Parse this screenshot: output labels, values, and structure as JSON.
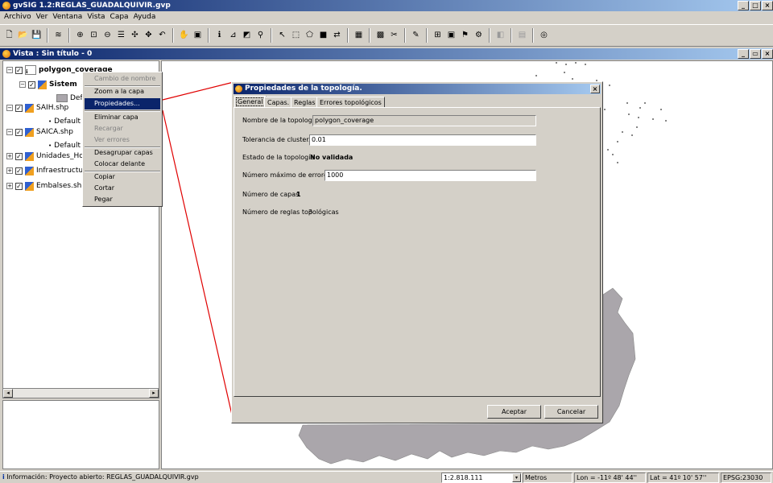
{
  "window": {
    "title": "gvSIG 1.2:REGLAS_GUADALQUIVIR.gvp"
  },
  "menu": [
    "Archivo",
    "Ver",
    "Ventana",
    "Vista",
    "Capa",
    "Ayuda"
  ],
  "view": {
    "title": "Vista : Sin título - 0"
  },
  "toc": {
    "layers": [
      {
        "name": "polygon_coverage"
      },
      {
        "name": "Sistem"
      },
      {
        "name": "Def"
      },
      {
        "name": "SAIH.shp"
      },
      {
        "name": "Default"
      },
      {
        "name": "SAICA.shp"
      },
      {
        "name": "Default"
      },
      {
        "name": "Unidades_Ho"
      },
      {
        "name": "Infraestructu"
      },
      {
        "name": "Embalses.shp"
      }
    ]
  },
  "context_menu": {
    "items": [
      "Cambio de nombre",
      "Zoom a la capa",
      "Propiedades...",
      "Eliminar capa",
      "Recargar",
      "Ver errores",
      "Desagrupar capas",
      "Colocar delante",
      "Copiar",
      "Cortar",
      "Pegar"
    ]
  },
  "dialog": {
    "title": "Propiedades de la topología.",
    "tabs": [
      "General",
      "Capas.",
      "Reglas",
      "Errores topológicos"
    ],
    "name_label": "Nombre de la topología",
    "name_value": "polygon_coverage",
    "tolerance_label": "Tolerancia de cluster.",
    "tolerance_value": "0.01",
    "state_label": "Estado de la topología",
    "state_value": "No validada",
    "maxerr_label": "Número máximo de errores",
    "maxerr_value": "1000",
    "layers_label": "Número de capas",
    "layers_value": "1",
    "rules_label": "Número de reglas topológicas",
    "rules_value": "3",
    "ok_label": "Aceptar",
    "cancel_label": "Cancelar"
  },
  "status": {
    "info": "Información: Proyecto abierto: REGLAS_GUADALQUIVIR.gvp",
    "scale": "1:2.818.111",
    "units": "Metros",
    "lon": "Lon = -11º 48' 44''",
    "lat": "Lat = 41º 10' 57''",
    "epsg": "EPSG:23030"
  },
  "colors": {
    "title_bar": "#0a246a",
    "selection": "#0a246a",
    "map_polygon": "#aaa6ab",
    "leader_line": "#e00000"
  }
}
